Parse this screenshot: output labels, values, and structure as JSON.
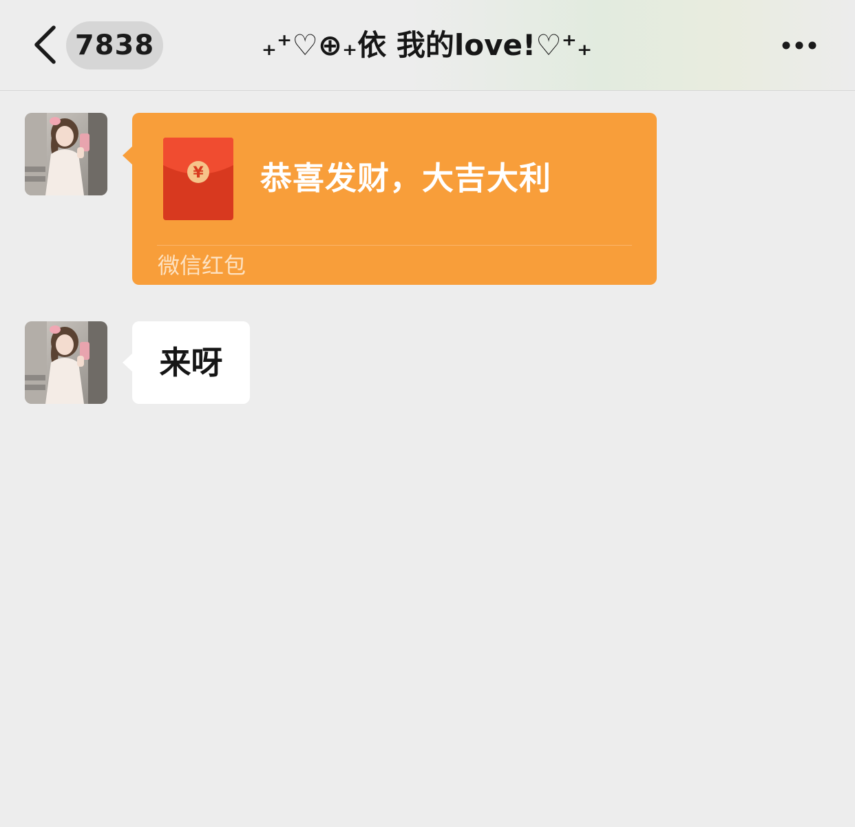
{
  "header": {
    "back_icon": "chevron-left-icon",
    "unread_count": "7838",
    "title": "₊⁺♡⊕₊依 我的love!♡⁺₊",
    "more_icon": "more-horizontal-icon"
  },
  "messages": [
    {
      "type": "red_packet",
      "sender": "contact",
      "avatar_icon": "contact-avatar",
      "greeting": "恭喜发财，大吉大利",
      "label": "微信红包",
      "packet_icon": "red-packet-icon",
      "currency_symbol": "¥"
    },
    {
      "type": "text",
      "sender": "contact",
      "avatar_icon": "contact-avatar",
      "text": "来呀"
    }
  ],
  "colors": {
    "background": "#ededed",
    "red_packet_bubble": "#f89e3a",
    "red_packet_envelope": "#e8452a",
    "text_bubble": "#ffffff"
  }
}
